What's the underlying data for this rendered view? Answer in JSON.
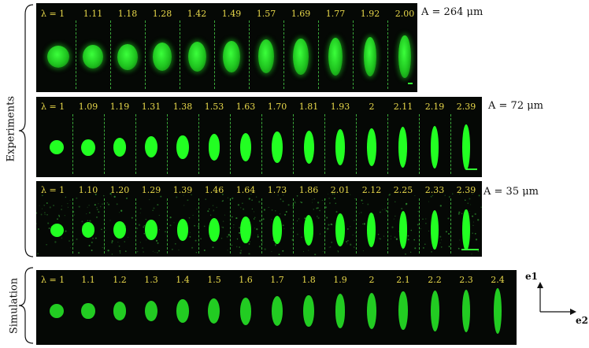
{
  "groups": {
    "experiments": "Experiments",
    "simulation": "Simulation"
  },
  "panels": [
    {
      "id": "a264",
      "area_label": "A = 264 μm",
      "stretch_ratios": [
        "λ = 1",
        "1.11",
        "1.18",
        "1.28",
        "1.42",
        "1.49",
        "1.57",
        "1.69",
        "1.77",
        "1.92",
        "2.00"
      ]
    },
    {
      "id": "a72",
      "area_label": "A = 72 μm",
      "stretch_ratios": [
        "λ = 1",
        "1.09",
        "1.19",
        "1.31",
        "1.38",
        "1.53",
        "1.63",
        "1.70",
        "1.81",
        "1.93",
        "2",
        "2.11",
        "2.19",
        "2.39"
      ]
    },
    {
      "id": "a35",
      "area_label": "A = 35 μm",
      "stretch_ratios": [
        "λ = 1",
        "1.10",
        "1.20",
        "1.29",
        "1.39",
        "1.46",
        "1.64",
        "1.73",
        "1.86",
        "2.01",
        "2.12",
        "2.25",
        "2.33",
        "2.39"
      ]
    },
    {
      "id": "sim",
      "area_label": "",
      "stretch_ratios": [
        "λ = 1",
        "1.1",
        "1.2",
        "1.3",
        "1.4",
        "1.5",
        "1.6",
        "1.7",
        "1.8",
        "1.9",
        "2",
        "2.1",
        "2.2",
        "2.3",
        "2.4"
      ]
    }
  ],
  "axes": {
    "e1": "e1",
    "e2": "e2"
  },
  "colors": {
    "cell_bright": "#22ff22",
    "cell_sim": "#22cc22",
    "label_yellow": "#e8d84a",
    "panel_bg": "#050805"
  }
}
